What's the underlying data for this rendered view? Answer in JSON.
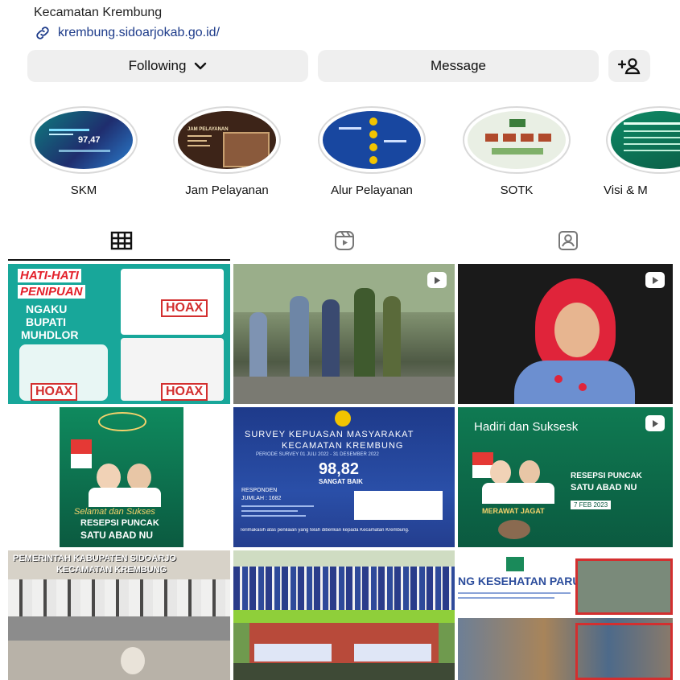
{
  "profile": {
    "name": "Kecamatan Krembung",
    "link": "krembung.sidoarjokab.go.id/"
  },
  "actions": {
    "following_label": "Following",
    "message_label": "Message"
  },
  "highlights": [
    {
      "label": "SKM",
      "thumb_text": "97,47"
    },
    {
      "label": "Jam Pelayanan",
      "thumb_text": "JAM PELAYANAN"
    },
    {
      "label": "Alur Pelayanan",
      "thumb_text": ""
    },
    {
      "label": "SOTK",
      "thumb_text": ""
    },
    {
      "label": "Visi & M",
      "thumb_text": ""
    }
  ],
  "tabs": [
    "posts",
    "reels",
    "tagged"
  ],
  "posts": {
    "p1": {
      "line1": "HATI-HATI",
      "line2": "PENIPUAN",
      "line3": "NGAKU",
      "line4": "BUPATI",
      "line5": "MUHDLOR",
      "hoax": "HOAX"
    },
    "p5": {
      "title1": "SURVEY KEPUASAN MASYARAKAT",
      "title2": "KECAMATAN KREMBUNG",
      "period": "PERIODE SURVEY 01 JULI 2022 - 31 DESEMBER 2022",
      "score": "98,82",
      "grade": "SANGAT BAIK",
      "responden": "RESPONDEN",
      "jumlah": "JUMLAH : 1682",
      "footer": "Terimakasih atas penilaian yang telah diberikan kepada Kecamatan Krembung."
    },
    "p4": {
      "top": "SATU ABAD NU",
      "sub": "RESEPSI PUNCAK",
      "script": "Selamat dan Sukses"
    },
    "p6": {
      "header": "Hadiri dan Suksesk",
      "title1": "RESEPSI PUNCAK",
      "title2": "SATU ABAD NU",
      "date": "7 FEB 2023",
      "slogan": "MERAWAT JAGAT"
    },
    "p7": {
      "line1": "PEMERINTAH KABUPATEN SIDOARJO",
      "line2": "KECAMATAN KREMBUNG"
    },
    "p9": {
      "title": "NG KESEHATAN PARU"
    }
  },
  "colors": {
    "link": "#1d3b8a",
    "button_bg": "#efefef",
    "nu_green": "#0f7a52",
    "skm_blue": "#1e3a8a",
    "hoax_red": "#d32f2f"
  }
}
